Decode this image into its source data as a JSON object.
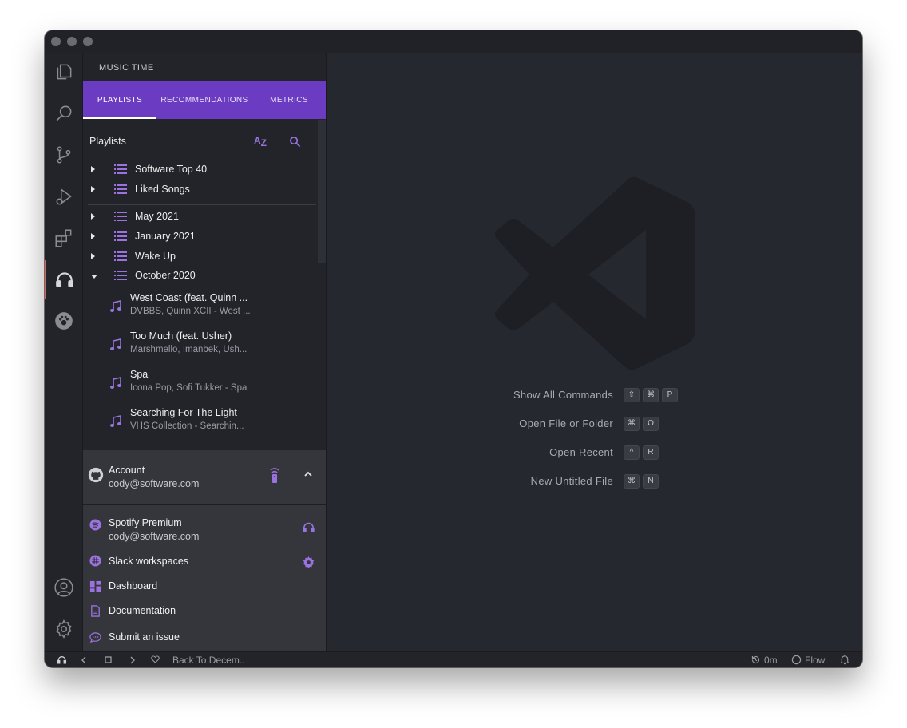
{
  "sidebar": {
    "title": "MUSIC TIME",
    "tabs": [
      {
        "label": "PLAYLISTS"
      },
      {
        "label": "RECOMMENDATIONS"
      },
      {
        "label": "METRICS"
      }
    ],
    "playlists_header": "Playlists",
    "playlists": [
      {
        "label": "Software Top 40",
        "expanded": false
      },
      {
        "label": "Liked Songs",
        "expanded": false
      },
      {
        "label": "May 2021",
        "expanded": false
      },
      {
        "label": "January 2021",
        "expanded": false
      },
      {
        "label": "Wake Up",
        "expanded": false
      },
      {
        "label": "October 2020",
        "expanded": true
      }
    ],
    "songs": [
      {
        "title": "West Coast (feat. Quinn ...",
        "subtitle": "DVBBS, Quinn XCII - West ..."
      },
      {
        "title": "Too Much (feat. Usher)",
        "subtitle": "Marshmello, Imanbek, Ush..."
      },
      {
        "title": "Spa",
        "subtitle": "Icona Pop, Sofi Tukker - Spa"
      },
      {
        "title": "Searching For The Light",
        "subtitle": "VHS Collection - Searchin..."
      }
    ]
  },
  "account": {
    "label": "Account",
    "email": "cody@software.com",
    "spotify_label": "Spotify Premium",
    "spotify_email": "cody@software.com",
    "slack_label": "Slack workspaces",
    "dashboard_label": "Dashboard",
    "documentation_label": "Documentation",
    "submit_issue_label": "Submit an issue"
  },
  "editor": {
    "shortcuts": [
      {
        "label": "Show All Commands",
        "keys": [
          "⇧",
          "⌘",
          "P"
        ]
      },
      {
        "label": "Open File or Folder",
        "keys": [
          "⌘",
          "O"
        ]
      },
      {
        "label": "Open Recent",
        "keys": [
          "^",
          "R"
        ]
      },
      {
        "label": "New Untitled File",
        "keys": [
          "⌘",
          "N"
        ]
      }
    ]
  },
  "statusbar": {
    "track": "Back To Decem..",
    "time": "0m",
    "flow": "Flow"
  },
  "colors": {
    "accent": "#6b3bc2",
    "icon_purple": "#9a73e0",
    "active_indicator": "#e2605a"
  }
}
